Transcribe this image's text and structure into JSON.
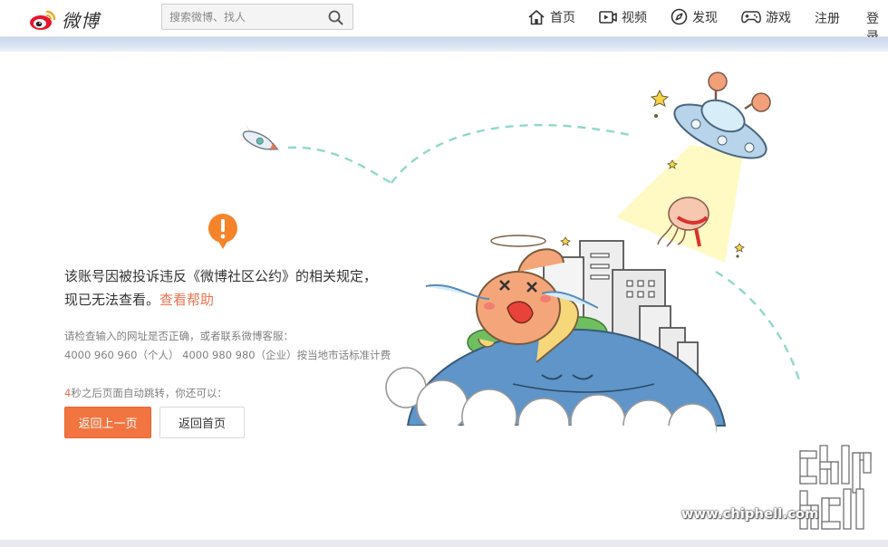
{
  "header": {
    "logo_text": "微博",
    "search_placeholder": "搜索微博、找人",
    "nav": [
      {
        "label": "首页",
        "icon": "home-icon"
      },
      {
        "label": "视频",
        "icon": "video-icon"
      },
      {
        "label": "发现",
        "icon": "compass-icon"
      },
      {
        "label": "游戏",
        "icon": "gamepad-icon"
      }
    ],
    "register_label": "注册",
    "login_label": "登录"
  },
  "main": {
    "message_text": "该账号因被投诉违反《微博社区公约》的相关规定，现已无法查看。",
    "help_link": "查看帮助",
    "hint_line1": "请检查输入的网址是否正确，或者联系微博客服：",
    "hint_line2": "4000 960 960（个人） 4000 980 980（企业）按当地市话标准计费",
    "countdown_number": "4",
    "countdown_text": "秒之后页面自动跳转，你还可以：",
    "back_button": "返回上一页",
    "home_button": "返回首页"
  },
  "watermark": {
    "url": "www.chiphell.com"
  },
  "colors": {
    "accent": "#f27440",
    "link": "#eb7350",
    "warning": "#f5832a"
  }
}
